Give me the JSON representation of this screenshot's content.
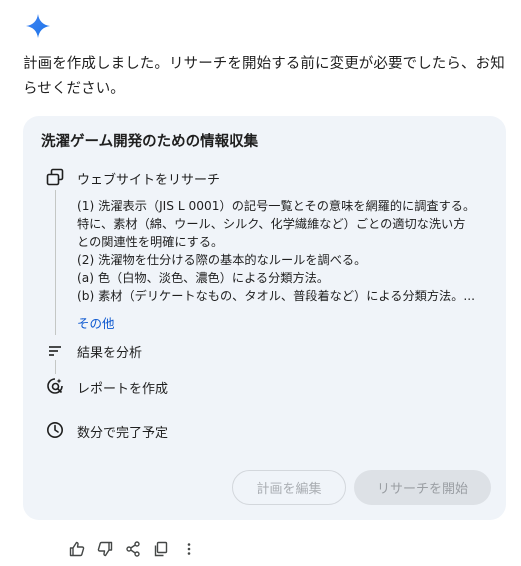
{
  "assistant": {
    "logo_icon": "gemini-sparkle-icon",
    "intro_line1": "計画を作成しました。リサーチを開始する前に変更が必要でしたら、お知",
    "intro_line2": "らせください。"
  },
  "plan": {
    "title": "洗濯ゲーム開発のための情報収集",
    "steps": [
      {
        "icon": "website-research-icon",
        "label": "ウェブサイトをリサーチ"
      },
      {
        "icon": "analyze-results-icon",
        "label": "結果を分析"
      },
      {
        "icon": "create-report-icon",
        "label": "レポートを作成"
      }
    ],
    "description_lines": [
      "(1) 洗濯表示（JIS L 0001）の記号一覧とその意味を網羅的に調査する。",
      "特に、素材（綿、ウール、シルク、化学繊維など）ごとの適切な洗い方",
      "との関連性を明確にする。",
      "(2) 洗濯物を仕分ける際の基本的なルールを調べる。",
      "(a) 色（白物、淡色、濃色）による分類方法。",
      "(b) 素材（デリケートなもの、タオル、普段着など）による分類方法。..."
    ],
    "more_label": "その他",
    "eta_icon": "clock-icon",
    "eta_label": "数分で完了予定",
    "edit_button": "計画を編集",
    "start_button": "リサーチを開始"
  },
  "actions": [
    {
      "icon": "thumbs-up-icon"
    },
    {
      "icon": "thumbs-down-icon"
    },
    {
      "icon": "share-icon"
    },
    {
      "icon": "copy-icon"
    },
    {
      "icon": "more-vert-icon"
    }
  ],
  "colors": {
    "accent": "#0b57d0",
    "card_bg": "#f0f4f9",
    "text": "#1f1f1f"
  }
}
